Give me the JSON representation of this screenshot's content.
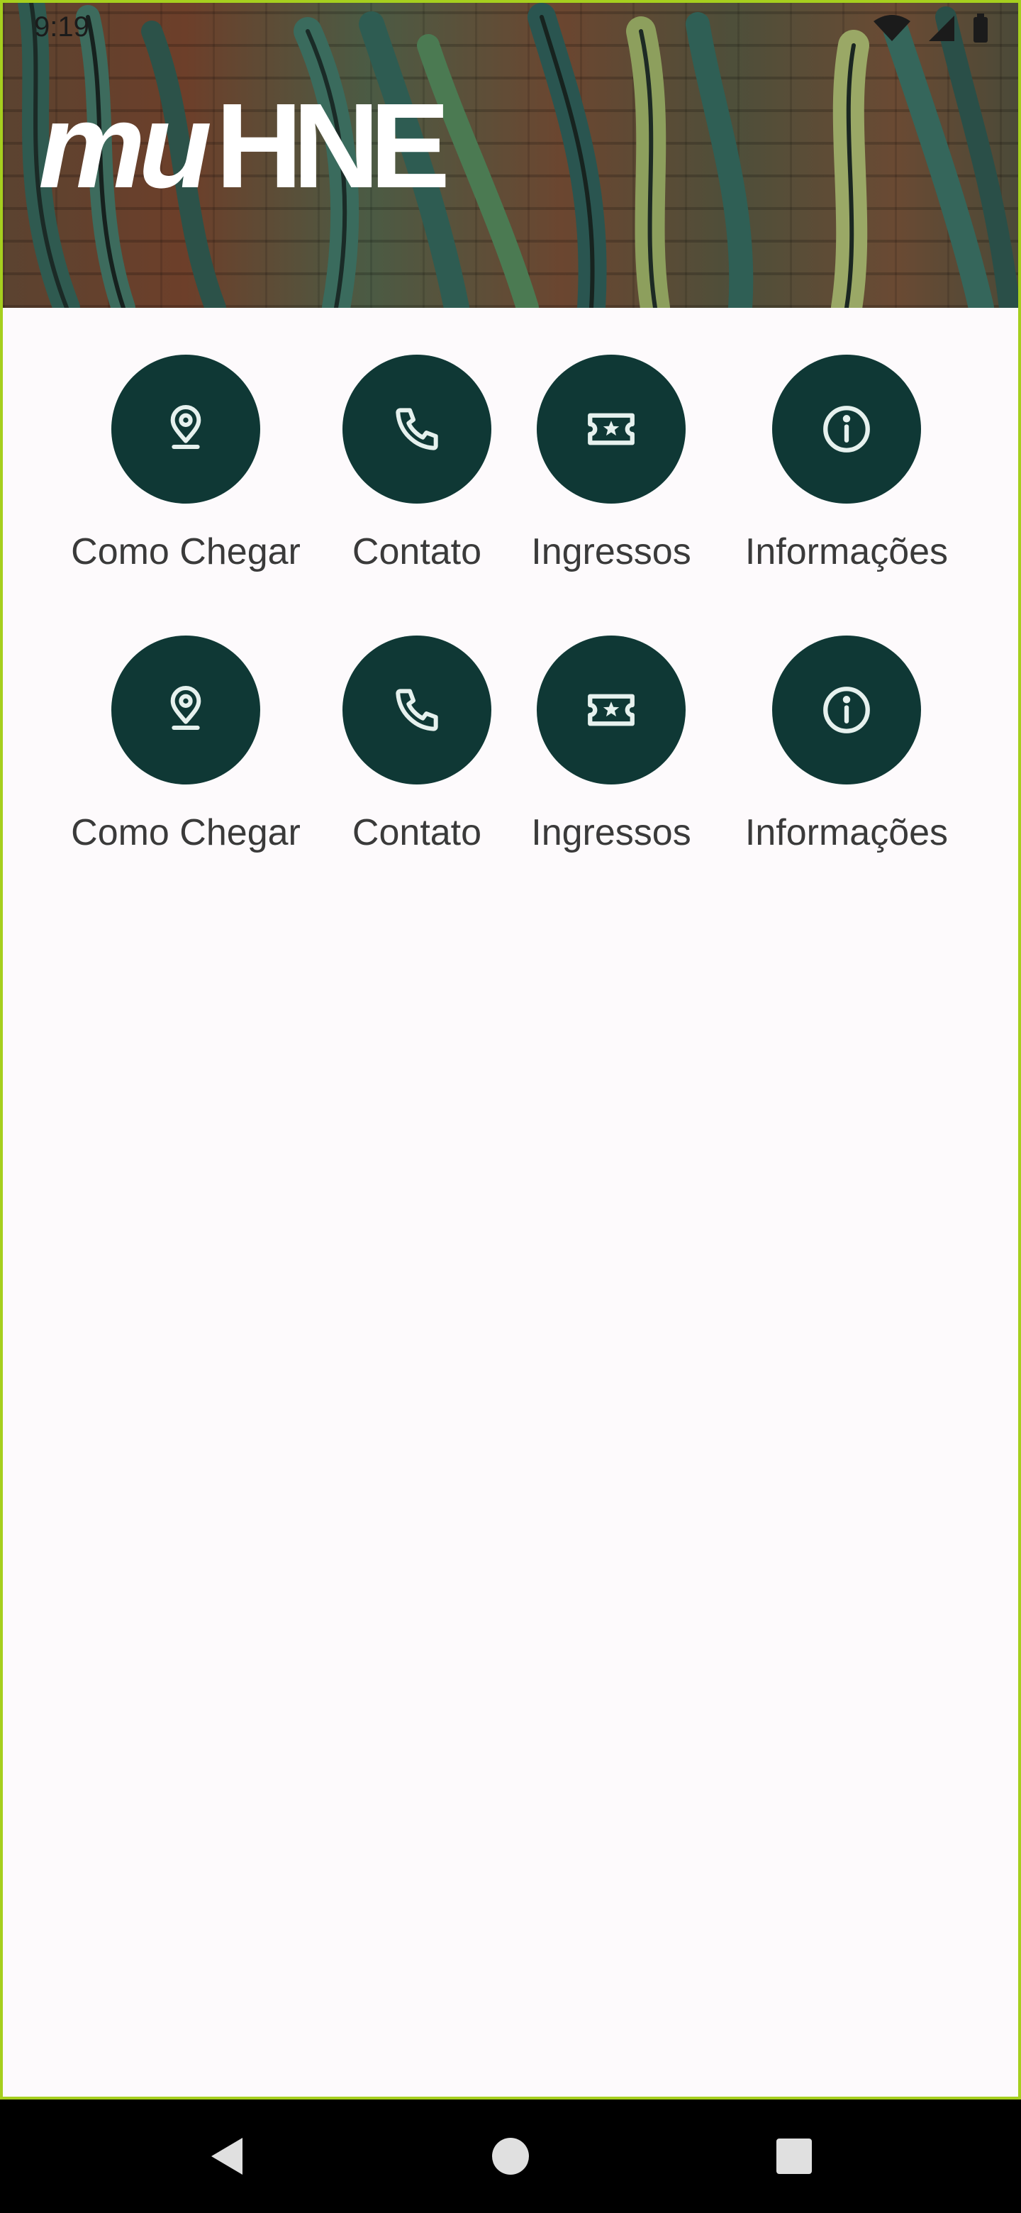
{
  "status_bar": {
    "time": "9:19"
  },
  "header": {
    "logo_alt": "muHNE",
    "logo_text_part1": "mu",
    "logo_text_part2": "HNE"
  },
  "rows": [
    [
      {
        "label": "Como Chegar",
        "icon": "location-pin-icon"
      },
      {
        "label": "Contato",
        "icon": "phone-icon"
      },
      {
        "label": "Ingressos",
        "icon": "ticket-icon"
      },
      {
        "label": "Informações",
        "icon": "info-icon"
      }
    ],
    [
      {
        "label": "Como Chegar",
        "icon": "location-pin-icon"
      },
      {
        "label": "Contato",
        "icon": "phone-icon"
      },
      {
        "label": "Ingressos",
        "icon": "ticket-icon"
      },
      {
        "label": "Informações",
        "icon": "info-icon"
      }
    ]
  ],
  "colors": {
    "accent": "#0f3835",
    "frame": "#a6cf1e",
    "background": "#fdfafc"
  },
  "nav_bar": {
    "back": "back-icon",
    "home": "home-icon",
    "recents": "recents-icon"
  }
}
